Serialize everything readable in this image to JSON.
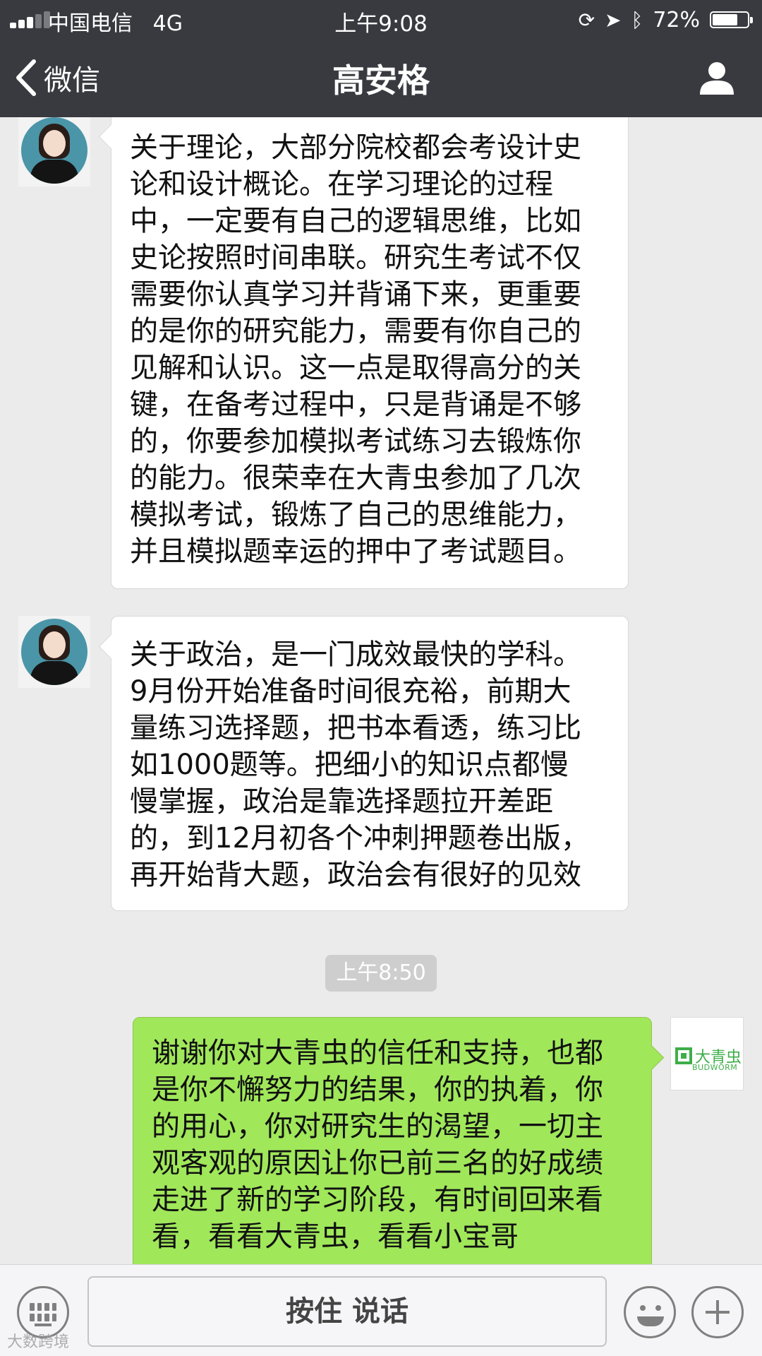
{
  "status_bar": {
    "carrier": "中国电信",
    "network": "4G",
    "time": "上午9:08",
    "battery": "72%",
    "battery_level": 0.72
  },
  "nav": {
    "back_label": "微信",
    "title": "高安格"
  },
  "messages": [
    {
      "side": "left",
      "lines": [
        "关于理论，大部分院校都会考设计史",
        "论和设计概论。在学习理论的过程",
        "中，一定要有自己的逻辑思维，比如",
        "史论按照时间串联。研究生考试不仅",
        "需要你认真学习并背诵下来，更重要",
        "的是你的研究能力，需要有你自己的",
        "见解和认识。这一点是取得高分的关",
        "键，在备考过程中，只是背诵是不够",
        "的，你要参加模拟考试练习去锻炼你",
        "的能力。很荣幸在大青虫参加了几次",
        "模拟考试，锻炼了自己的思维能力，",
        "并且模拟题幸运的押中了考试题目。"
      ]
    },
    {
      "side": "left",
      "lines": [
        "关于政治，是一门成效最快的学科。",
        "9月份开始准备时间很充裕，前期大",
        "量练习选择题，把书本看透，练习比",
        "如1000题等。把细小的知识点都慢",
        "慢掌握，政治是靠选择题拉开差距",
        "的，到12月初各个冲刺押题卷出版，",
        "再开始背大题，政治会有很好的见效"
      ]
    },
    {
      "side": "right",
      "lines": [
        "谢谢你对大青虫的信任和支持，也都",
        "是你不懈努力的结果，你的执着，你",
        "的用心，你对研究生的渴望，一切主",
        "观客观的原因让你已前三名的好成绩",
        "走进了新的学习阶段，有时间回来看",
        "看，看看大青虫，看看小宝哥"
      ]
    }
  ],
  "timestamp": "上午8:50",
  "brand_avatar": {
    "cn": "大青虫",
    "en": "BUDWORM"
  },
  "bottom_bar": {
    "talk_label": "按住 说话"
  },
  "watermark": "大数跨境"
}
